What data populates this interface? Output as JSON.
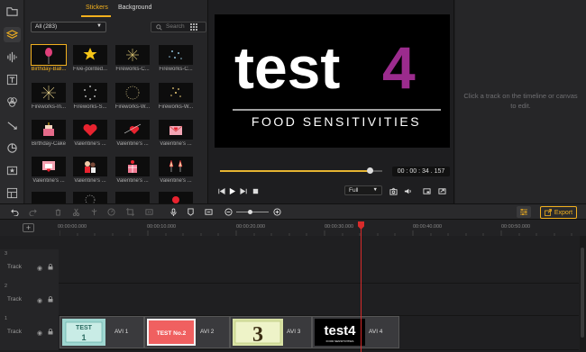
{
  "media": {
    "tabs": [
      "Stickers",
      "Background"
    ],
    "active_tab": "Stickers",
    "filter_value": "All (283)",
    "search_placeholder": "Search",
    "items": [
      {
        "label": "Birthday-Ball...",
        "selected": true
      },
      {
        "label": "Five-pointed..."
      },
      {
        "label": "Fireworks-C..."
      },
      {
        "label": "Fireworks-C..."
      },
      {
        "label": "Fireworks-In..."
      },
      {
        "label": "Fireworks-S..."
      },
      {
        "label": "Fireworks-W..."
      },
      {
        "label": "Fireworks-W..."
      },
      {
        "label": "Birthday-Cake"
      },
      {
        "label": "Valentine's ..."
      },
      {
        "label": "Valentine's ..."
      },
      {
        "label": "Valentine's ..."
      },
      {
        "label": "Valentine's ..."
      },
      {
        "label": "Valentine's ..."
      },
      {
        "label": "Valentine's ..."
      },
      {
        "label": "Valentine's ..."
      }
    ]
  },
  "preview": {
    "title_main": "test",
    "title_digit": "4",
    "subtitle": "FOOD SENSITIVITIES",
    "timecode": "00 : 00 : 34 . 157",
    "progress": 0.92,
    "zoom_value": "Full"
  },
  "properties": {
    "hint": "Click a track on the timeline or canvas to edit."
  },
  "toolbar": {
    "export_label": "Export"
  },
  "ruler": {
    "add_label": "+",
    "ticks": [
      "00:00:00.000",
      "00:00:10.000",
      "00:00:20.000",
      "00:00:30.000",
      "00:00:40.000",
      "00:00:50.000"
    ]
  },
  "tracks": [
    {
      "number": "3",
      "name": "Track"
    },
    {
      "number": "2",
      "name": "Track"
    },
    {
      "number": "1",
      "name": "Track"
    }
  ],
  "clips": [
    {
      "label": "AVI 1",
      "thumb_text": "TEST",
      "thumb_sub": "1"
    },
    {
      "label": "AVI 2",
      "thumb_text": "TEST No.2"
    },
    {
      "label": "AVI 3",
      "thumb_text": "3"
    },
    {
      "label": "AVI 4",
      "thumb_text": "test4",
      "thumb_sub": "FOOD SENSITIVITIES"
    }
  ],
  "colors": {
    "accent": "#f2b01e",
    "playhead": "#d92b2b",
    "brand_purple": "#9b2b8d"
  }
}
